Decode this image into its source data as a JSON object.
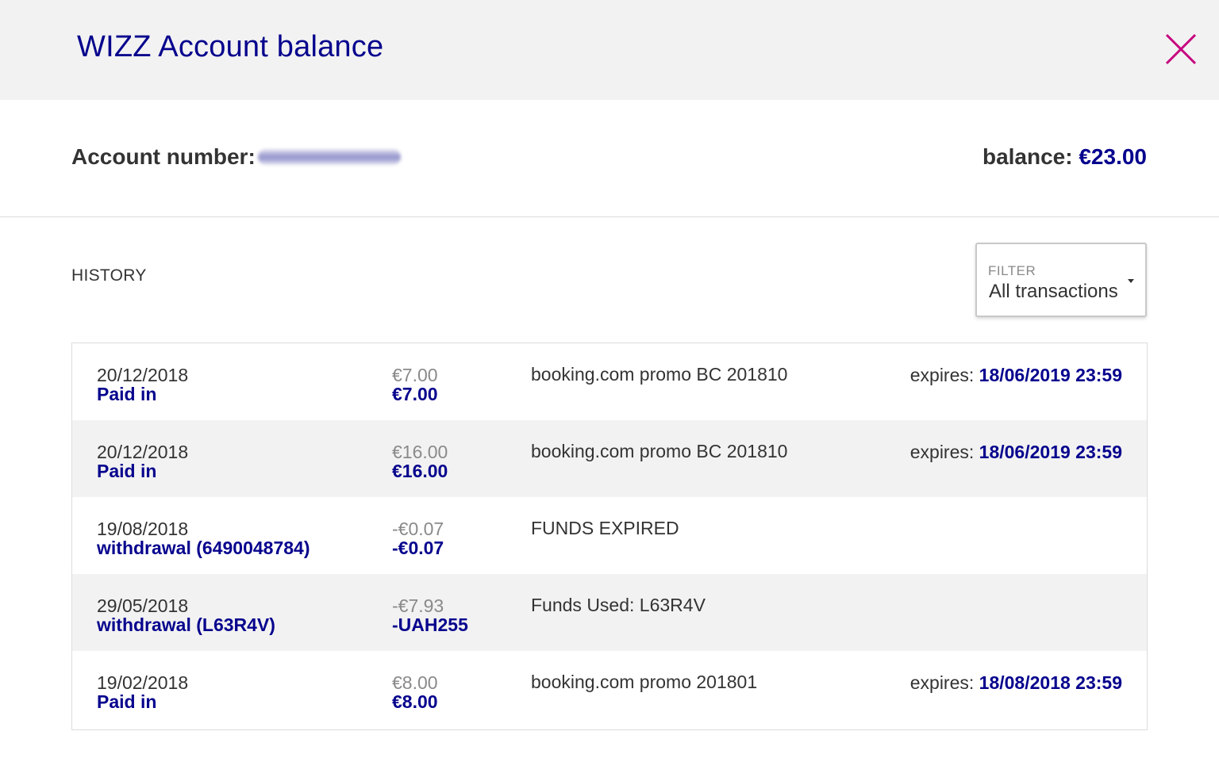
{
  "header": {
    "title": "WIZZ Account balance",
    "close_icon": "close-icon"
  },
  "account": {
    "number_label": "Account number:",
    "number_value": "",
    "balance_label": "balance:",
    "balance_value": "€23.00"
  },
  "history": {
    "label": "HISTORY"
  },
  "filter": {
    "label": "FILTER",
    "selected": "All transactions"
  },
  "transactions": [
    {
      "date": "20/12/2018",
      "type": "Paid in",
      "original_amount": "€7.00",
      "amount": "€7.00",
      "description": "booking.com promo BC 201810",
      "expires_label": "expires:",
      "expires_value": "18/06/2019 23:59"
    },
    {
      "date": "20/12/2018",
      "type": "Paid in",
      "original_amount": "€16.00",
      "amount": "€16.00",
      "description": "booking.com promo BC 201810",
      "expires_label": "expires:",
      "expires_value": "18/06/2019 23:59"
    },
    {
      "date": "19/08/2018",
      "type": "withdrawal (6490048784)",
      "original_amount": "-€0.07",
      "amount": "-€0.07",
      "description": "FUNDS EXPIRED",
      "expires_label": "",
      "expires_value": ""
    },
    {
      "date": "29/05/2018",
      "type": "withdrawal (L63R4V)",
      "original_amount": "-€7.93",
      "amount": "-UAH255",
      "description": "Funds Used: L63R4V",
      "expires_label": "",
      "expires_value": ""
    },
    {
      "date": "19/02/2018",
      "type": "Paid in",
      "original_amount": "€8.00",
      "amount": "€8.00",
      "description": "booking.com promo 201801",
      "expires_label": "expires:",
      "expires_value": "18/08/2018 23:59"
    }
  ],
  "colors": {
    "brand": "#06038d",
    "close": "#c6007e",
    "muted": "#8a8a8a",
    "header_bg": "#f2f2f2"
  }
}
